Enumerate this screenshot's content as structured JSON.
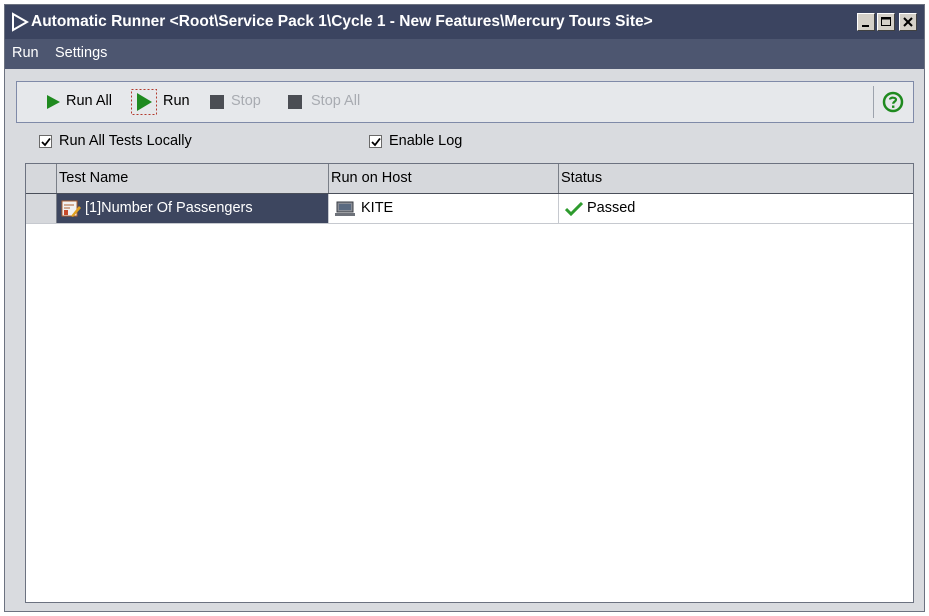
{
  "window": {
    "title": "Automatic Runner <Root\\Service Pack 1\\Cycle 1 - New Features\\Mercury Tours Site>",
    "controls": [
      "minimize-icon",
      "maximize-icon",
      "close-icon"
    ]
  },
  "menu": {
    "items": [
      {
        "label": "Run"
      },
      {
        "label": "Settings"
      }
    ]
  },
  "toolbar": {
    "run_all_label": "Run All",
    "run_label": "Run",
    "stop_label": "Stop",
    "stop_all_label": "Stop All",
    "help_icon": "help-icon"
  },
  "options": {
    "run_all_tests_locally": {
      "label": "Run All Tests Locally",
      "checked": true
    },
    "enable_log": {
      "label": "Enable Log",
      "checked": true
    }
  },
  "grid": {
    "columns": [
      "Test Name",
      "Run on Host",
      "Status"
    ],
    "rows": [
      {
        "test_name": "[1]Number Of Passengers",
        "run_on_host": "KITE",
        "status": "Passed",
        "status_icon": "checkmark-icon"
      }
    ]
  },
  "colors": {
    "titlebar": "#3b4460",
    "menubar": "#4d5670",
    "window_bg": "#d9dbdf",
    "selected_cell": "#3d465f",
    "run_green": "#1f8a1f",
    "passed_green": "#2e9b2e"
  }
}
